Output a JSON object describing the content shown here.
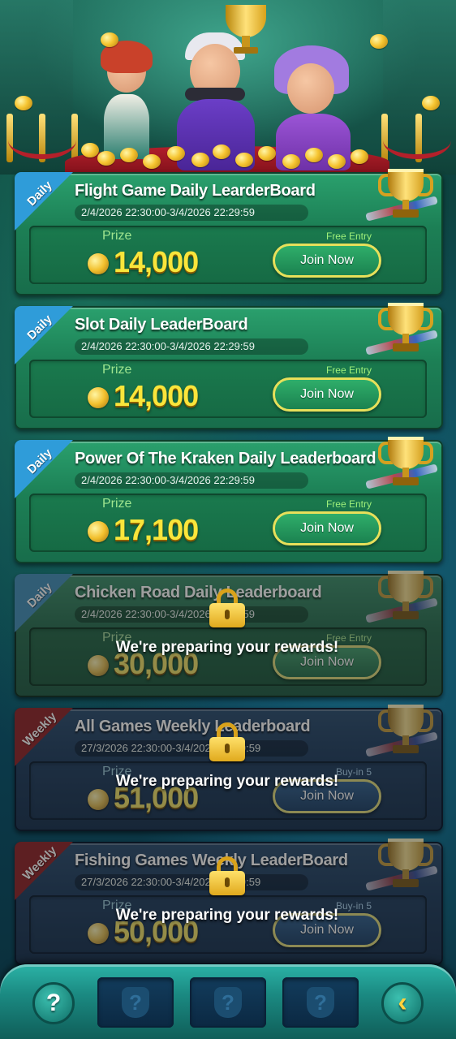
{
  "cards": [
    {
      "tag": "Daily",
      "title": "Flight Game Daily LearderBoard",
      "dates": "2/4/2026 22:30:00-3/4/2026 22:29:59",
      "prize_label": "Prize",
      "prize_value": "14,000",
      "entry_label": "Free Entry",
      "join_label": "Join Now",
      "locked": false
    },
    {
      "tag": "Daily",
      "title": "Slot Daily LeaderBoard",
      "dates": "2/4/2026 22:30:00-3/4/2026 22:29:59",
      "prize_label": "Prize",
      "prize_value": "14,000",
      "entry_label": "Free Entry",
      "join_label": "Join Now",
      "locked": false
    },
    {
      "tag": "Daily",
      "title": "Power Of The Kraken Daily Leaderboard",
      "dates": "2/4/2026 22:30:00-3/4/2026 22:29:59",
      "prize_label": "Prize",
      "prize_value": "17,100",
      "entry_label": "Free Entry",
      "join_label": "Join Now",
      "locked": false
    },
    {
      "tag": "Daily",
      "title": "Chicken Road Daily Leaderboard",
      "dates": "2/4/2026 22:30:00-3/4/2026 22:29:59",
      "prize_label": "Prize",
      "prize_value": "30,000",
      "entry_label": "Free Entry",
      "join_label": "Join Now",
      "locked": true,
      "lock_message": "We're preparing your rewards!"
    },
    {
      "tag": "Weekly",
      "title": "All Games Weekly Leaderboard",
      "dates": "27/3/2026 22:30:00-3/4/2026 22:29:59",
      "prize_label": "Prize",
      "prize_value": "51,000",
      "entry_label": "Buy-in 5",
      "join_label": "Join Now",
      "locked": true,
      "lock_message": "We're preparing your rewards!"
    },
    {
      "tag": "Weekly",
      "title": "Fishing Games Weekly LeaderBoard",
      "dates": "27/3/2026 22:30:00-3/4/2026 22:29:59",
      "prize_label": "Prize",
      "prize_value": "50,000",
      "entry_label": "Buy-in 5",
      "join_label": "Join Now",
      "locked": true,
      "lock_message": "We're preparing your rewards!"
    }
  ],
  "bottom_bar": {
    "help_label": "?",
    "slot_label": "?",
    "back_label": "‹"
  },
  "colors": {
    "daily_ribbon": "#2f9cd9",
    "weekly_ribbon": "#c0262e",
    "prize_value": "#f9e53b",
    "join_border": "#e7e05a"
  }
}
